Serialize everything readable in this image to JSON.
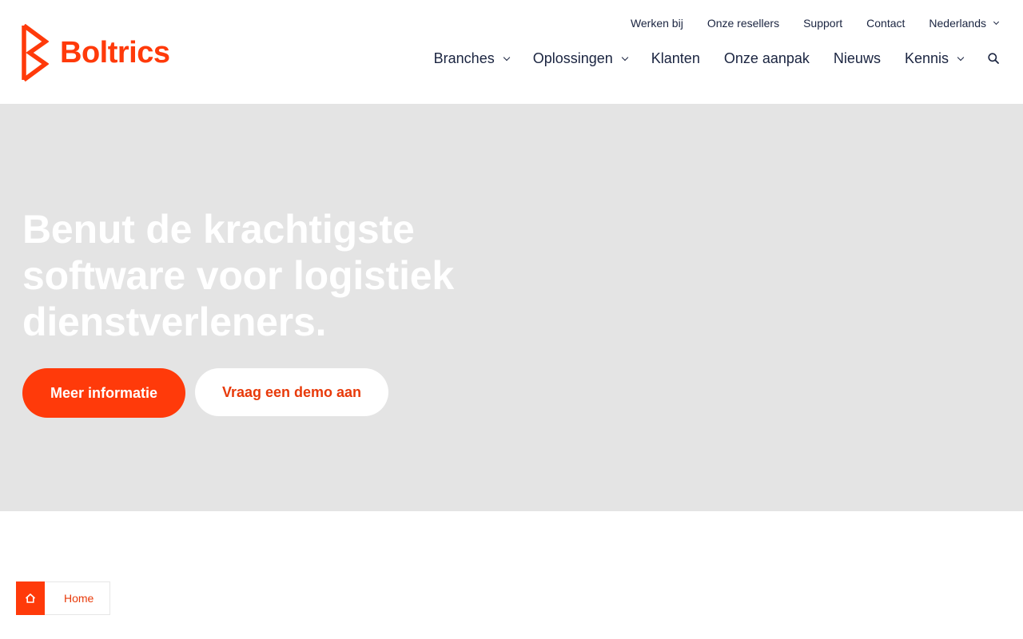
{
  "brand": {
    "name": "Boltrics",
    "accent_color": "#ff3a0a",
    "text_color": "#1a2440"
  },
  "top_nav": {
    "items": [
      {
        "label": "Werken bij"
      },
      {
        "label": "Onze resellers"
      },
      {
        "label": "Support"
      },
      {
        "label": "Contact"
      },
      {
        "label": "Nederlands",
        "has_dropdown": true
      }
    ]
  },
  "main_nav": {
    "items": [
      {
        "label": "Branches",
        "has_dropdown": true
      },
      {
        "label": "Oplossingen",
        "has_dropdown": true
      },
      {
        "label": "Klanten"
      },
      {
        "label": "Onze aanpak"
      },
      {
        "label": "Nieuws"
      },
      {
        "label": "Kennis",
        "has_dropdown": true
      }
    ],
    "search_icon": "search-icon"
  },
  "hero": {
    "title": "Benut de krachtigste software voor logistiek dienstverleners.",
    "primary_button": "Meer informatie",
    "secondary_button": "Vraag een demo aan",
    "background_color": "#e4e4e4"
  },
  "breadcrumb": {
    "icon": "home-icon",
    "label": "Home"
  }
}
